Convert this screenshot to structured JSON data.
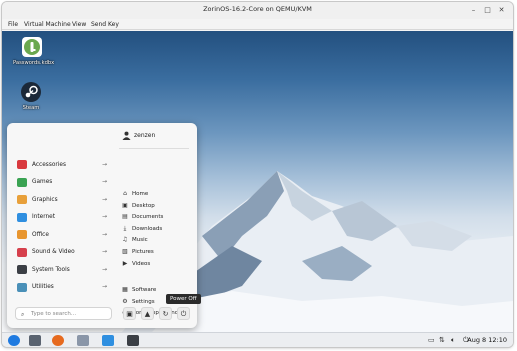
{
  "window": {
    "title": "ZorinOS-16.2-Core on QEMU/KVM",
    "controls": {
      "minimize": "–",
      "maximize": "□",
      "close": "✕"
    }
  },
  "menubar": {
    "file": "File",
    "virtual_machine": "Virtual Machine",
    "view": "View",
    "send_key": "Send Key"
  },
  "desktop": {
    "icons": [
      {
        "label": "Passwords.kdbx",
        "icon": "keepass-icon"
      },
      {
        "label": "Steam",
        "icon": "steam-icon"
      }
    ]
  },
  "start_menu": {
    "categories": [
      {
        "label": "Accessories",
        "icon": "accessories-icon",
        "color": "#d9393e"
      },
      {
        "label": "Games",
        "icon": "games-icon",
        "color": "#3aa353"
      },
      {
        "label": "Graphics",
        "icon": "graphics-icon",
        "color": "#e8a03a"
      },
      {
        "label": "Internet",
        "icon": "internet-icon",
        "color": "#2f8fe0"
      },
      {
        "label": "Office",
        "icon": "office-icon",
        "color": "#e8952e"
      },
      {
        "label": "Sound & Video",
        "icon": "sound-video-icon",
        "color": "#d6404c"
      },
      {
        "label": "System Tools",
        "icon": "system-tools-icon",
        "color": "#3b3f45"
      },
      {
        "label": "Utilities",
        "icon": "utilities-icon",
        "color": "#4a90b8"
      }
    ],
    "arrow": "→",
    "user": {
      "name": "zenzen"
    },
    "places": [
      {
        "label": "Home",
        "icon": "home-icon",
        "glyph": "⌂"
      },
      {
        "label": "Desktop",
        "icon": "desktop-icon",
        "glyph": "▣"
      },
      {
        "label": "Documents",
        "icon": "documents-icon",
        "glyph": "▤"
      },
      {
        "label": "Downloads",
        "icon": "downloads-icon",
        "glyph": "⤓"
      },
      {
        "label": "Music",
        "icon": "music-icon",
        "glyph": "♫"
      },
      {
        "label": "Pictures",
        "icon": "pictures-icon",
        "glyph": "▧"
      },
      {
        "label": "Videos",
        "icon": "videos-icon",
        "glyph": "▶"
      }
    ],
    "system_links": [
      {
        "label": "Software",
        "icon": "software-icon",
        "glyph": "▦"
      },
      {
        "label": "Settings",
        "icon": "settings-icon",
        "glyph": "⚙"
      },
      {
        "label": "Zorin Appearance",
        "icon": "appearance-icon",
        "glyph": "◐"
      }
    ],
    "search_placeholder": "Type to search...",
    "buttons": [
      {
        "name": "screenshot-button",
        "icon": "screenshot-icon",
        "glyph": "▣"
      },
      {
        "name": "lock-button",
        "icon": "lock-icon",
        "glyph": "▲"
      },
      {
        "name": "restart-button",
        "icon": "restart-icon",
        "glyph": "↻"
      },
      {
        "name": "power-off-button",
        "icon": "power-icon",
        "glyph": "⏻"
      }
    ],
    "tooltip": "Power Off"
  },
  "taskbar": {
    "apps": [
      {
        "name": "zorin-menu",
        "icon": "zorin-logo-icon",
        "color": "#1f7ae0"
      },
      {
        "name": "show-desktop",
        "icon": "show-desktop-icon",
        "color": "#5a6370"
      },
      {
        "name": "firefox",
        "icon": "firefox-icon",
        "color": "#e66a1f"
      },
      {
        "name": "files",
        "icon": "files-icon",
        "color": "#8a96a8"
      },
      {
        "name": "software",
        "icon": "software-store-icon",
        "color": "#2f8fe0"
      },
      {
        "name": "terminal",
        "icon": "terminal-icon",
        "color": "#3b3f45"
      }
    ],
    "clock": "Aug 8  12:10"
  }
}
